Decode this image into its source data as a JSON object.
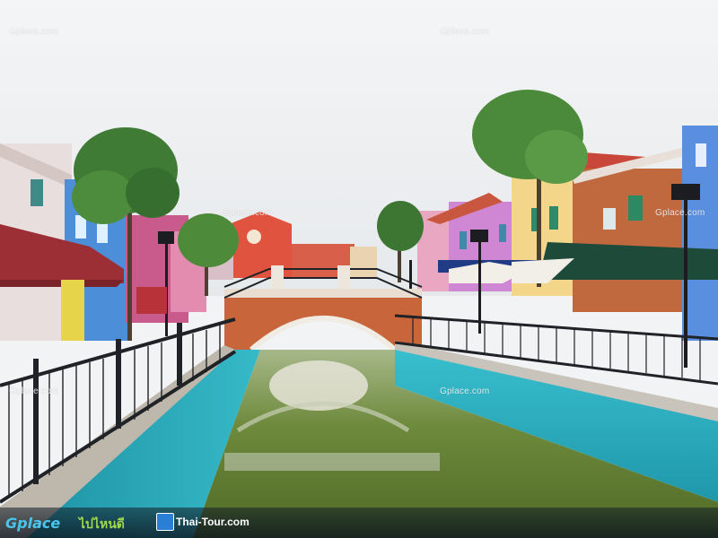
{
  "watermarks": {
    "top_left": "Gplace.com",
    "top_center": "Gplace.com",
    "bridge": "Gplace.com",
    "mid_left": "Gplace.com",
    "mid_center": "Gplace.com",
    "right_building": "Gplace.com"
  },
  "footer": {
    "logo_gplace": "Gplace",
    "logo_thai": "ไปไหนดี",
    "logo_thaitour": "Thai-Tour.com"
  },
  "colors": {
    "sky": "#eef0f2",
    "canal_wall": "#2fb3c4",
    "water": "#6f8a3e",
    "bridge_brick": "#c8653a",
    "fence": "#1f2226"
  }
}
